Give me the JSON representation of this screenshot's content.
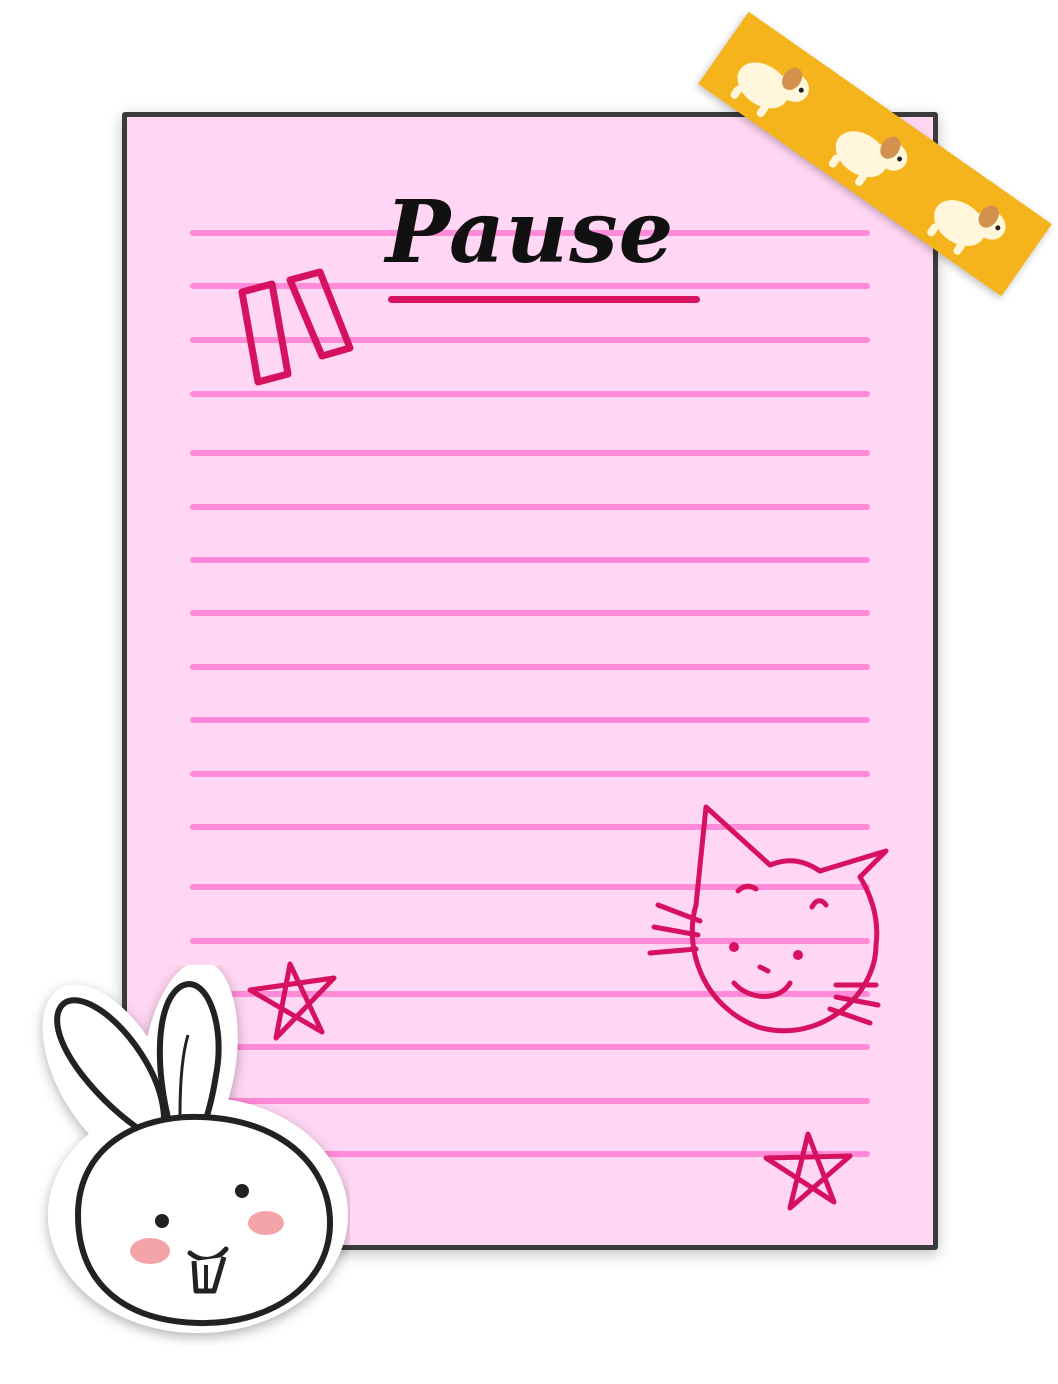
{
  "note": {
    "title": "Pause"
  },
  "colors": {
    "paper": "#ffd6f3",
    "ruled_line": "#ff8ad8",
    "border": "#3a3a3a",
    "doodle_ink": "#d6115f",
    "tape": "#f5b41b",
    "title_ink": "#111111"
  },
  "icons": {
    "pause_doodle": "pause-icon",
    "cat_doodle": "cat-face-icon",
    "star_doodle": "star-icon",
    "bunny_sticker": "bunny-face-icon",
    "tape": "puppy-washi-tape"
  }
}
